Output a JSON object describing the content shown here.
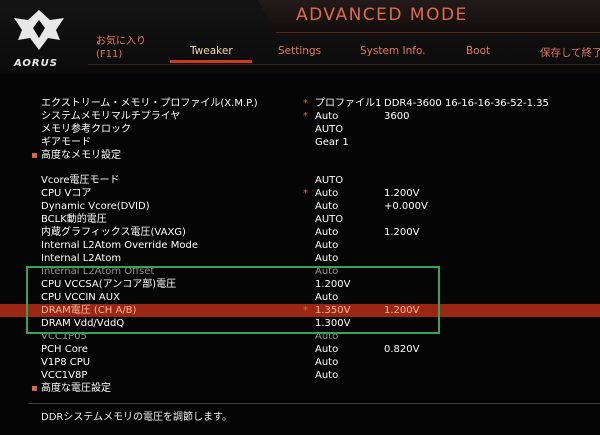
{
  "header": {
    "mode_title": "ADVANCED MODE",
    "logo_text": "AORUS",
    "favorites_line1": "お気に入り",
    "favorites_line2": "(F11)",
    "tabs": [
      {
        "label": "Tweaker",
        "active": true
      },
      {
        "label": "Settings",
        "active": false
      },
      {
        "label": "System Info.",
        "active": false
      },
      {
        "label": "Boot",
        "active": false
      }
    ],
    "save_exit": "保存して終了"
  },
  "rows": [
    {
      "label": "エクストリーム・メモリ・プロファイル(X.M.P.)",
      "star": true,
      "val1": "プロファイル1",
      "val2": "DDR4-3600 16-16-16-36-52-1.35"
    },
    {
      "label": "システムメモリマルチプライヤ",
      "star": true,
      "val1": "Auto",
      "val2": "3600"
    },
    {
      "label": "メモリ参考クロック",
      "star": false,
      "val1": "AUTO",
      "val2": ""
    },
    {
      "label": "ギアモード",
      "star": false,
      "val1": "Gear 1",
      "val2": ""
    },
    {
      "label": "高度なメモリ設定",
      "bullet": true
    },
    {
      "label": "Vcore電圧モード",
      "star": false,
      "val1": "AUTO",
      "val2": ""
    },
    {
      "label": "CPU Vコア",
      "star": true,
      "val1": "Auto",
      "val2": "1.200V"
    },
    {
      "label": "Dynamic Vcore(DVID)",
      "star": false,
      "val1": "Auto",
      "val2": "+0.000V"
    },
    {
      "label": "BCLK動的電圧",
      "star": false,
      "val1": "AUTO",
      "val2": ""
    },
    {
      "label": "内蔵グラフィックス電圧(VAXG)",
      "star": false,
      "val1": "Auto",
      "val2": "1.200V"
    },
    {
      "label": "Internal L2Atom Override Mode",
      "star": false,
      "val1": "Auto",
      "val2": ""
    },
    {
      "label": "Internal L2Atom",
      "star": false,
      "val1": "Auto",
      "val2": ""
    },
    {
      "label": "Internal L2Atom Offset",
      "star": false,
      "val1": "Auto",
      "val2": "",
      "dim": true
    },
    {
      "label": "CPU VCCSA(アンコア部)電圧",
      "star": false,
      "val1": "1.200V",
      "val2": ""
    },
    {
      "label": "CPU VCCIN AUX",
      "star": false,
      "val1": "Auto",
      "val2": ""
    },
    {
      "label": "DRAM電圧 (CH A/B)",
      "star": true,
      "val1": "1.350V",
      "val2": "1.200V",
      "highlight": true
    },
    {
      "label": "DRAM Vdd/VddQ",
      "star": false,
      "val1": "1.300V",
      "val2": ""
    },
    {
      "label": "VCC1P05",
      "star": false,
      "val1": "Auto",
      "val2": "",
      "dim": true
    },
    {
      "label": "PCH Core",
      "star": false,
      "val1": "Auto",
      "val2": "0.820V"
    },
    {
      "label": "V1P8 CPU",
      "star": false,
      "val1": "Auto",
      "val2": ""
    },
    {
      "label": "VCC1V8P",
      "star": false,
      "val1": "Auto",
      "val2": ""
    },
    {
      "label": "高度な電圧設定",
      "bullet": true
    }
  ],
  "help_text": "DDRシステムメモリの電圧を調節します。",
  "colors": {
    "accent": "#e0683f",
    "highlight": "#9a2714",
    "box": "#35a455"
  }
}
